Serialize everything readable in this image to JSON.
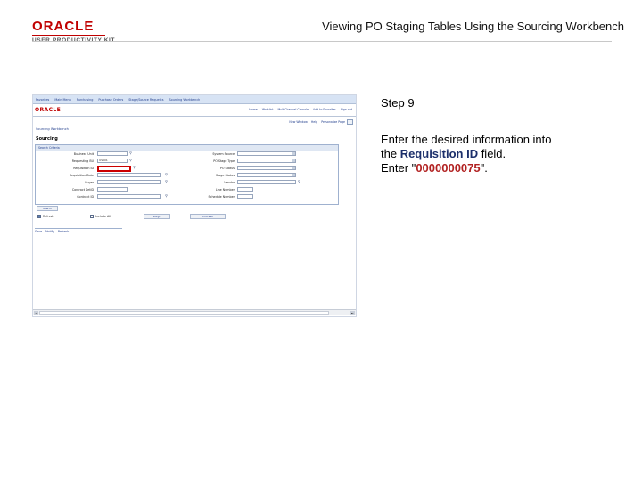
{
  "header": {
    "logo_brand": "ORACLE",
    "logo_product": "USER PRODUCTIVITY KIT",
    "title": "Viewing PO Staging Tables Using the Sourcing Workbench"
  },
  "instructions": {
    "step": "Step 9",
    "line1": "Enter the desired information into",
    "line2_prefix": "the ",
    "line2_field": "Requisition ID",
    "line2_suffix": " field.",
    "line3_prefix": "Enter \"",
    "line3_value": "0000000075",
    "line3_suffix": "\"."
  },
  "app": {
    "brand": "ORACLE",
    "nav": [
      "Favorites",
      "Main Menu",
      "Purchasing",
      "Purchase Orders",
      "Stage/Source Requests",
      "Sourcing Workbench"
    ],
    "menu": [
      "Home",
      "Worklist",
      "MultiChannel Console",
      "Add to Favorites",
      "Sign out"
    ],
    "links": [
      "New Window",
      "Help",
      "Personalize Page"
    ],
    "breadcrumb": "Sourcing Workbench",
    "page_title": "Sourcing",
    "group_title": "Search Criteria",
    "left_labels": [
      "Business Unit",
      "Requesting BU",
      "Requisition ID",
      "Requisition Date",
      "Buyer",
      "Contract SetID",
      "Contract ID"
    ],
    "right_labels": [
      "System Source",
      "PO Stage Type",
      "PO Status",
      "Stage Status",
      "Vendor",
      "Line Number",
      "Schedule Number"
    ],
    "requesting_bu_value": "US001",
    "search_button": "Search",
    "checkbox_refresh": "Refresh",
    "checkbox_include": "Include All",
    "purge_button": "Purge",
    "process_button": "Process",
    "bottom_actions": [
      "Save",
      "Notify",
      "Refresh"
    ],
    "scroll_left": "◄",
    "scroll_right": "►"
  }
}
